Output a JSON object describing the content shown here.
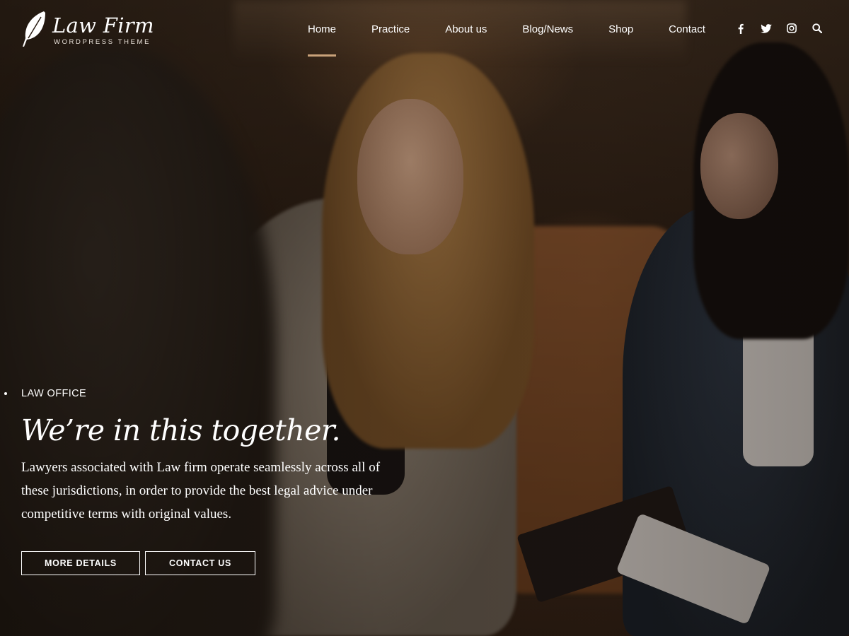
{
  "brand": {
    "name": "Law Firm",
    "tagline": "WORDPRESS THEME",
    "logo_icon": "feather-quill-icon"
  },
  "nav": {
    "items": [
      {
        "label": "Home",
        "active": true
      },
      {
        "label": "Practice",
        "active": false
      },
      {
        "label": "About us",
        "active": false
      },
      {
        "label": "Blog/News",
        "active": false
      },
      {
        "label": "Shop",
        "active": false
      },
      {
        "label": "Contact",
        "active": false
      }
    ],
    "accent_color": "#c9a27a"
  },
  "social": {
    "icons": [
      "facebook-icon",
      "twitter-icon",
      "instagram-icon",
      "search-icon"
    ]
  },
  "hero": {
    "kicker": "LAW OFFICE",
    "headline": "We’re in this together.",
    "lede": "Lawyers associated with Law firm operate seamlessly across all of these jurisdictions, in order to provide the best legal advice under competitive terms with original values.",
    "buttons": {
      "details": "MORE DETAILS",
      "contact": "CONTACT US"
    }
  }
}
